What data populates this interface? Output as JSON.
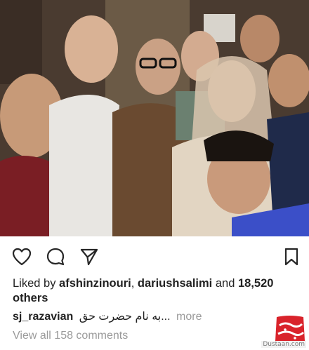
{
  "post": {
    "photo_alt": "Group selfie of nine people",
    "actions": {
      "like_icon": "heart-icon",
      "comment_icon": "comment-bubble-icon",
      "share_icon": "paper-plane-icon",
      "save_icon": "bookmark-icon"
    },
    "likes": {
      "prefix": "Liked by ",
      "user1": "afshinzinouri",
      "separator": ", ",
      "user2": "dariushsalimi",
      "middle": " and ",
      "count": "18,520",
      "suffix": " others"
    },
    "caption": {
      "username": "sj_razavian",
      "text": "...به نام حضرت حق",
      "more_label": "more"
    },
    "view_all_comments": "View all 158 comments"
  },
  "watermark": {
    "logo_text": "مجله دوستاسا",
    "url": "Dustaan.com"
  },
  "colors": {
    "text": "#262626",
    "muted": "#9a9a9a",
    "watermark_red": "#d9232b"
  }
}
